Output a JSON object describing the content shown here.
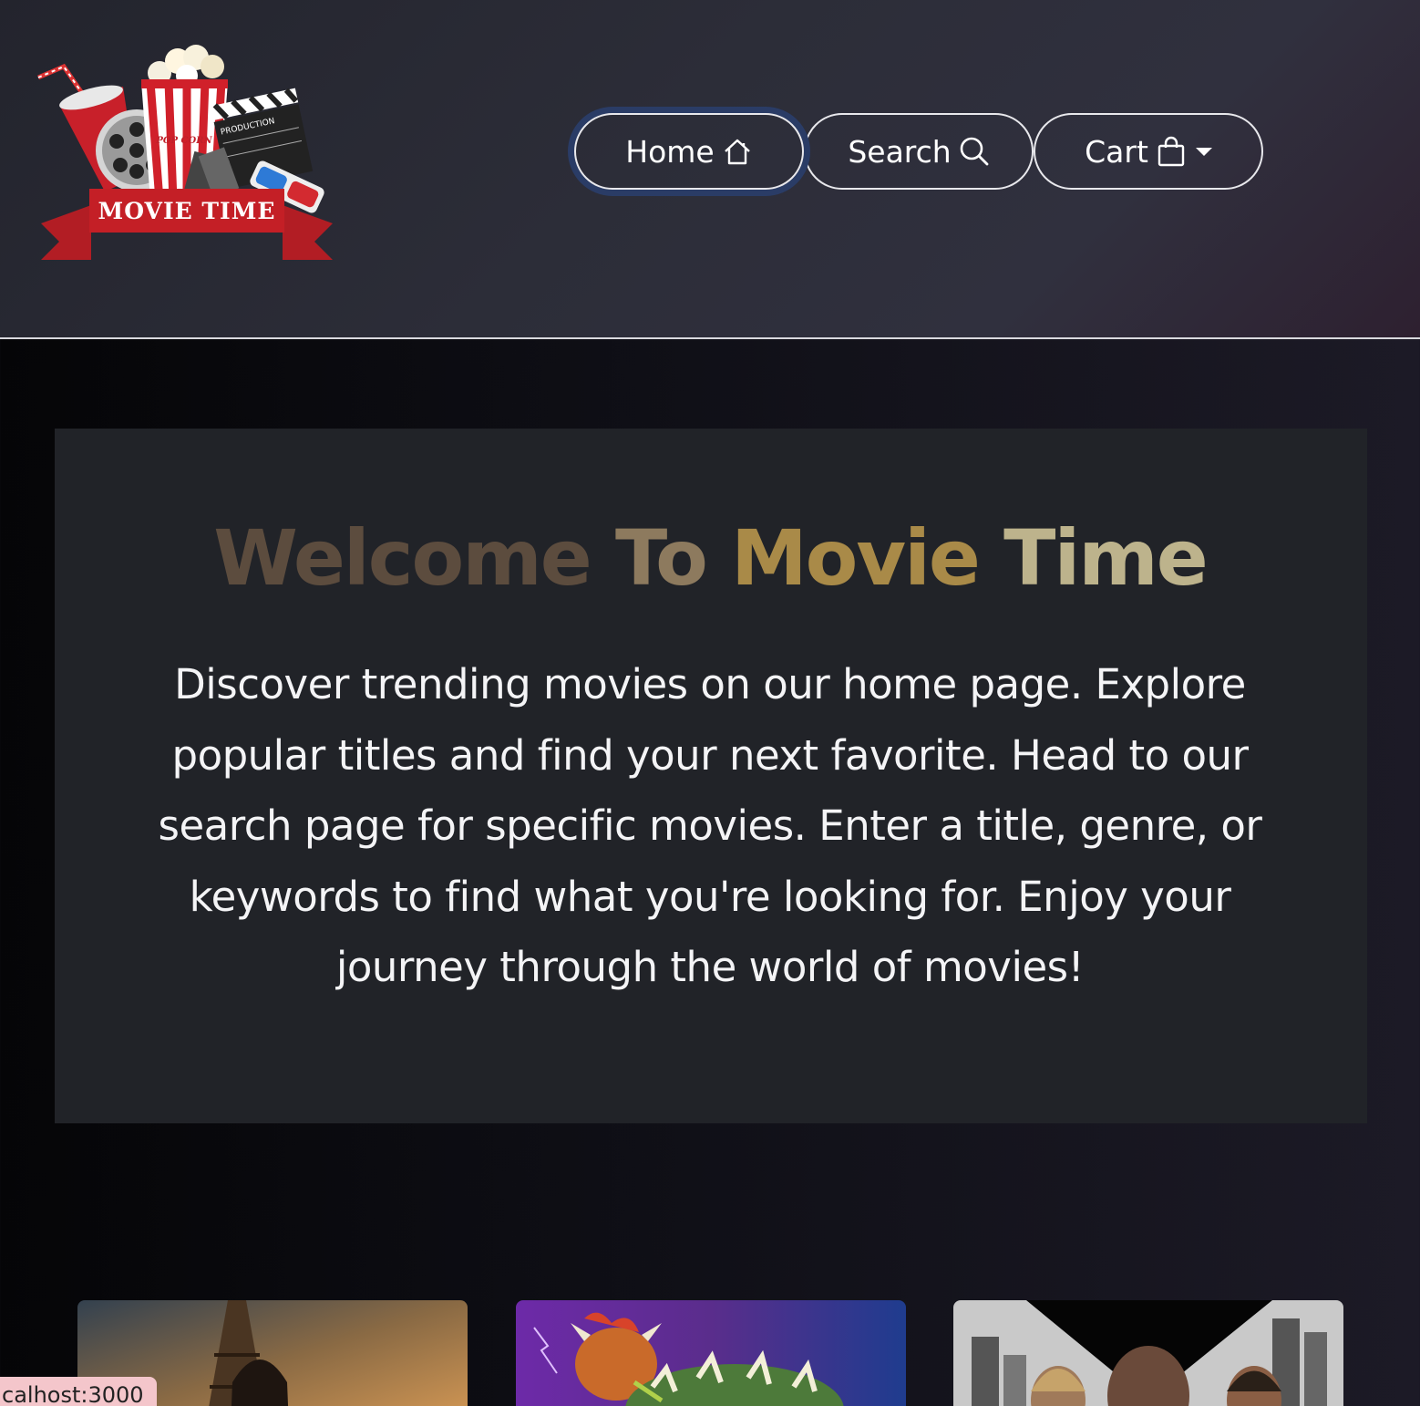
{
  "header": {
    "logo_text": "MOVIE TIME",
    "nav": [
      {
        "label": "Home",
        "icon": "home-icon",
        "active": true
      },
      {
        "label": "Search",
        "icon": "search-icon"
      },
      {
        "label": "Cart",
        "icon": "shopping-bag-icon",
        "dropdown": true
      }
    ]
  },
  "hero": {
    "title_words": [
      "Welcome",
      "To",
      "Movie",
      "Time"
    ],
    "description": "Discover trending movies on our home page. Explore popular titles and find your next favorite. Head to our search page for specific movies. Enter a title, genre, or keywords to find what you're looking for. Enjoy your journey through the world of movies!"
  },
  "movies": [
    {
      "poster": "john-wick-poster"
    },
    {
      "poster": "mario-bowser-poster"
    },
    {
      "poster": "fast-x-poster"
    }
  ],
  "status_bar": {
    "url": "calhost:3000"
  },
  "colors": {
    "accent_focus": "#2a3c66",
    "title_gradient": [
      "#5c4c3e",
      "#8d7a5e",
      "#a98a48",
      "#bdb38c"
    ],
    "hero_bg": "#212328"
  }
}
